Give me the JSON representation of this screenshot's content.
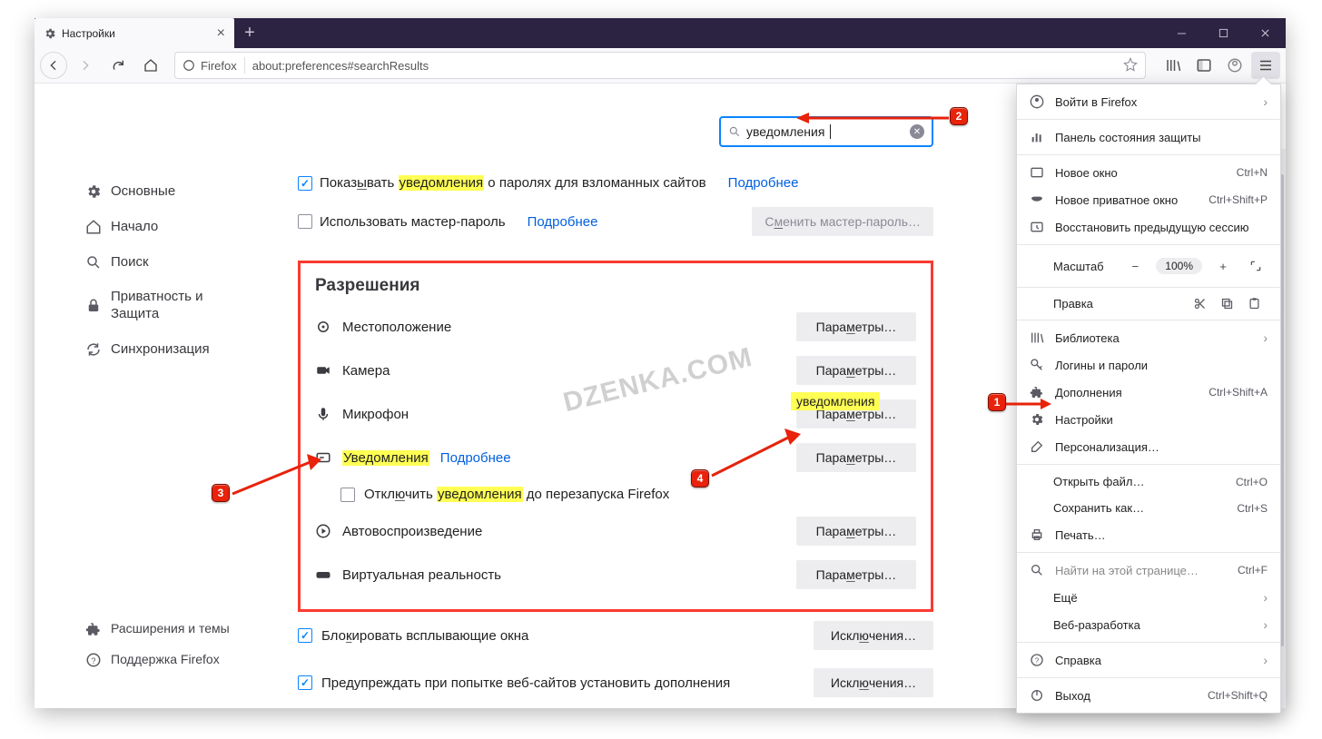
{
  "titlebar": {
    "tab_title": "Настройки"
  },
  "urlbar": {
    "identity": "Firefox",
    "url": "about:preferences#searchResults"
  },
  "sidebar": {
    "general": "Основные",
    "home": "Начало",
    "search": "Поиск",
    "privacy": "Приватность и Защита",
    "sync": "Синхронизация",
    "ext_themes": "Расширения и темы",
    "support": "Поддержка Firefox"
  },
  "search": {
    "value": "уведомления"
  },
  "passwords": {
    "show_breach_pre": "Показ",
    "show_breach_und": "ы",
    "show_breach_mid": "вать ",
    "show_breach_hl": "уведомления",
    "show_breach_post": " о паролях для взломанных сайтов",
    "more": "Подробнее",
    "use_master": "Использовать мастер-пароль",
    "change_master_pre": "С",
    "change_master_und": "м",
    "change_master_post": "енить мастер-пароль…"
  },
  "perm": {
    "title": "Разрешения",
    "location": "Местоположение",
    "camera": "Камера",
    "microphone": "Микрофон",
    "notifications": "Уведомления",
    "more": "Подробнее",
    "block_pre": "Откл",
    "block_und": "ю",
    "block_mid": "чить ",
    "block_hl": "уведомления",
    "block_post": " до перезапуска Firefox",
    "autoplay": "Автовоспроизведение",
    "vr": "Виртуальная реальность",
    "popups_pre": "Бло",
    "popups_und": "к",
    "popups_post": "ировать всплывающие окна",
    "warn_pre": "Пре",
    "warn_und": "д",
    "warn_post": "упреждать при попытке веб-сайтов установить дополнения",
    "btn_pre": "Пара",
    "btn_und": "м",
    "btn_post": "етры…",
    "exc_pre": "Искл",
    "exc_und": "ю",
    "exc_post": "чения…",
    "notif_tag": "уведомления"
  },
  "menu": {
    "signin": "Войти в Firefox",
    "protection": "Панель состояния защиты",
    "new_window": "Новое окно",
    "new_window_sc": "Ctrl+N",
    "new_private": "Новое приватное окно",
    "new_private_sc": "Ctrl+Shift+P",
    "restore": "Восстановить предыдущую сессию",
    "zoom_label": "Масштаб",
    "zoom_value": "100%",
    "edit_label": "Правка",
    "library": "Библиотека",
    "logins": "Логины и пароли",
    "addons": "Дополнения",
    "addons_sc": "Ctrl+Shift+A",
    "settings": "Настройки",
    "customize": "Персонализация…",
    "open_file": "Открыть файл…",
    "open_file_sc": "Ctrl+O",
    "save_as": "Сохранить как…",
    "save_as_sc": "Ctrl+S",
    "print": "Печать…",
    "find": "Найти на этой странице…",
    "find_sc": "Ctrl+F",
    "more": "Ещё",
    "webdev": "Веб-разработка",
    "help": "Справка",
    "quit": "Выход",
    "quit_sc": "Ctrl+Shift+Q"
  },
  "watermark": "DZENKA.COM",
  "callouts": {
    "c1": "1",
    "c2": "2",
    "c3": "3",
    "c4": "4"
  }
}
